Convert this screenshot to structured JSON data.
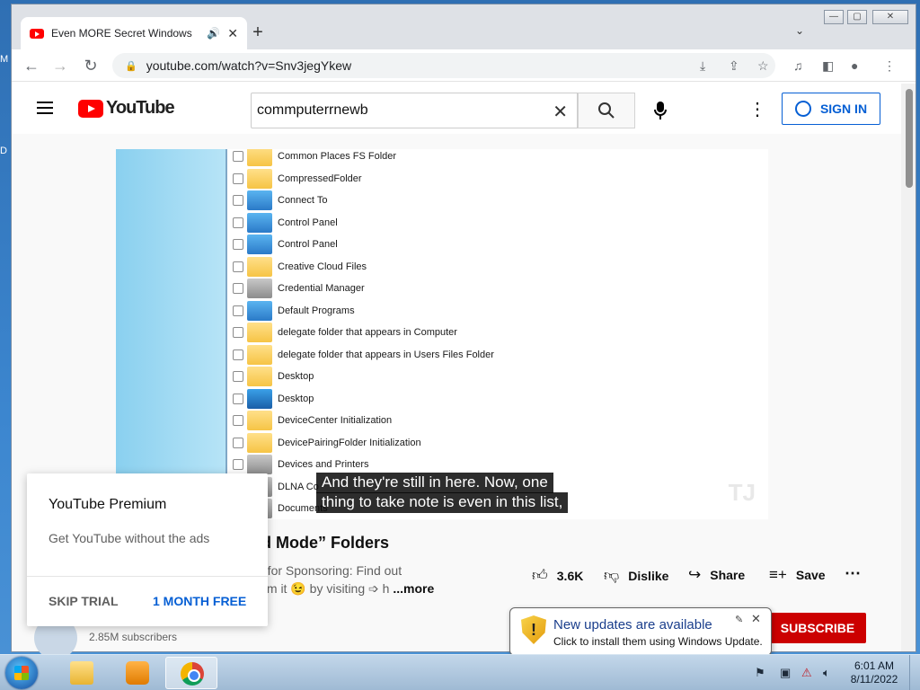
{
  "desktop": {
    "edge_letters": [
      "M",
      "D"
    ]
  },
  "browser": {
    "tab_title": "Even MORE Secret Windows",
    "url": "youtube.com/watch?v=Snv3jegYkew"
  },
  "youtube": {
    "logo_text": "YouTube",
    "search_query": "commputerrnewb",
    "sign_in_label": "SIGN IN",
    "video": {
      "list_items": [
        {
          "label": "Common Places FS Folder",
          "icon": "folder"
        },
        {
          "label": "CompressedFolder",
          "icon": "folder"
        },
        {
          "label": "Connect To",
          "icon": "cp"
        },
        {
          "label": "Control Panel",
          "icon": "cp"
        },
        {
          "label": "Control Panel",
          "icon": "cp"
        },
        {
          "label": "Creative Cloud Files",
          "icon": "red"
        },
        {
          "label": "Credential Manager",
          "icon": "gray"
        },
        {
          "label": "Default Programs",
          "icon": "cp"
        },
        {
          "label": "delegate folder that appears in Computer",
          "icon": "folder"
        },
        {
          "label": "delegate folder that appears in Users Files Folder",
          "icon": "folder"
        },
        {
          "label": "Desktop",
          "icon": "folder"
        },
        {
          "label": "Desktop",
          "icon": "desk"
        },
        {
          "label": "DeviceCenter Initialization",
          "icon": "folder"
        },
        {
          "label": "DevicePairingFolder Initialization",
          "icon": "folder"
        },
        {
          "label": "Devices and Printers",
          "icon": "gray"
        },
        {
          "label": "DLNA Co",
          "icon": "gray"
        },
        {
          "label": "Documents",
          "icon": "gray"
        }
      ],
      "caption_line1": "And they're still in here. Now, one",
      "caption_line2": "thing to take note is even in this list,",
      "watermark": "TJ"
    },
    "title_fragment": "od Mode” Folders",
    "description_line1": "e for Sponsoring: Find out",
    "description_line2": "aim it 😉 by visiting ➩ h",
    "more_label": "...more",
    "actions": {
      "likes": "3.6K",
      "dislike": "Dislike",
      "share": "Share",
      "save": "Save"
    },
    "subscribe_label": "SUBSCRIBE",
    "subscribers": "2.85M subscribers",
    "premium": {
      "title": "YouTube Premium",
      "description": "Get YouTube without the ads",
      "skip_label": "SKIP TRIAL",
      "free_label": "1 MONTH FREE"
    }
  },
  "notification": {
    "title": "New updates are available",
    "subtitle": "Click to install them using Windows Update."
  },
  "taskbar": {
    "time": "6:01 AM",
    "date": "8/11/2022"
  }
}
